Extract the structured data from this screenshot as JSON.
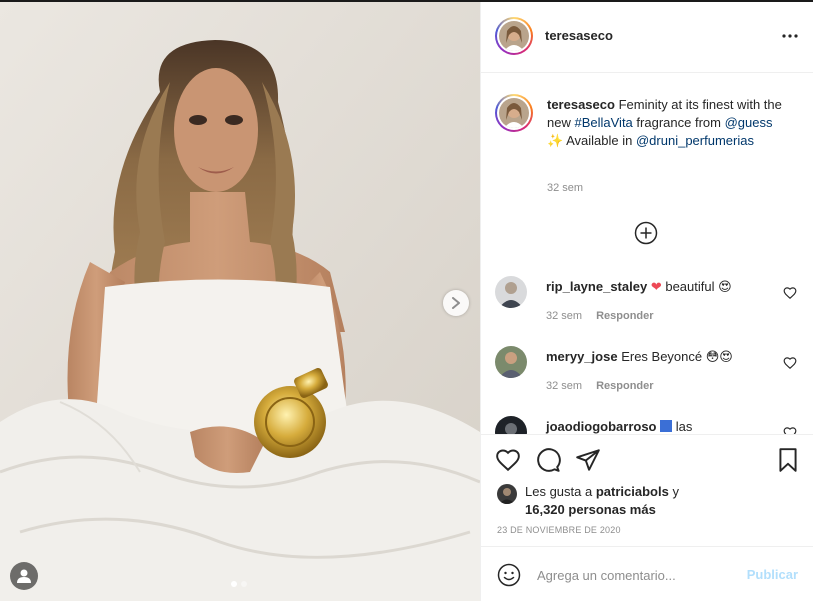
{
  "post": {
    "author": "teresaseco",
    "image_alt": "Woman with long wavy hair wrapped in white sheets holding a gold perfume bottle"
  },
  "header": {
    "username": "teresaseco",
    "more_icon": "more-horizontal-icon"
  },
  "caption": {
    "username": "teresaseco",
    "text_part1": "Feminity at its finest with the new",
    "hashtag": "#BellaVita",
    "text_part2": "fragrance from",
    "mention1": "@guess",
    "emoji": "✨",
    "text_part3": "Available in",
    "mention2": "@druni_perfumerias",
    "time": "32 sem"
  },
  "load_more_icon": "plus-circle-icon",
  "comments": [
    {
      "username": "rip_layne_staley",
      "emoji_before": "❤",
      "text": "beautiful",
      "emoji_after": "😍",
      "time": "32 sem",
      "reply": "Responder"
    },
    {
      "username": "meryy_jose",
      "emoji_before": "",
      "text": "Eres Beyoncé",
      "emoji_after": "😳😍",
      "time": "32 sem",
      "reply": "Responder"
    },
    {
      "username": "joaodiogobarroso",
      "emoji_before": "",
      "text": "las",
      "emoji_after": "",
      "time": "",
      "reply": ""
    }
  ],
  "actions": {
    "like_icon": "heart-icon",
    "comment_icon": "comment-icon",
    "share_icon": "share-icon",
    "save_icon": "bookmark-icon"
  },
  "likes": {
    "prefix": "Les gusta a",
    "user": "patriciabols",
    "connector": "y",
    "count": "16,320 personas más"
  },
  "date": "23 de noviembre de 2020",
  "add_comment": {
    "placeholder": "Agrega un comentario...",
    "publish": "Publicar",
    "emoji_icon": "smiley-icon"
  },
  "carousel": {
    "current": 1,
    "total": 2
  },
  "colors": {
    "link": "#00376b",
    "muted": "#8e8e8e",
    "publish_disabled": "#b2dffc",
    "like_red": "#ed4956"
  }
}
